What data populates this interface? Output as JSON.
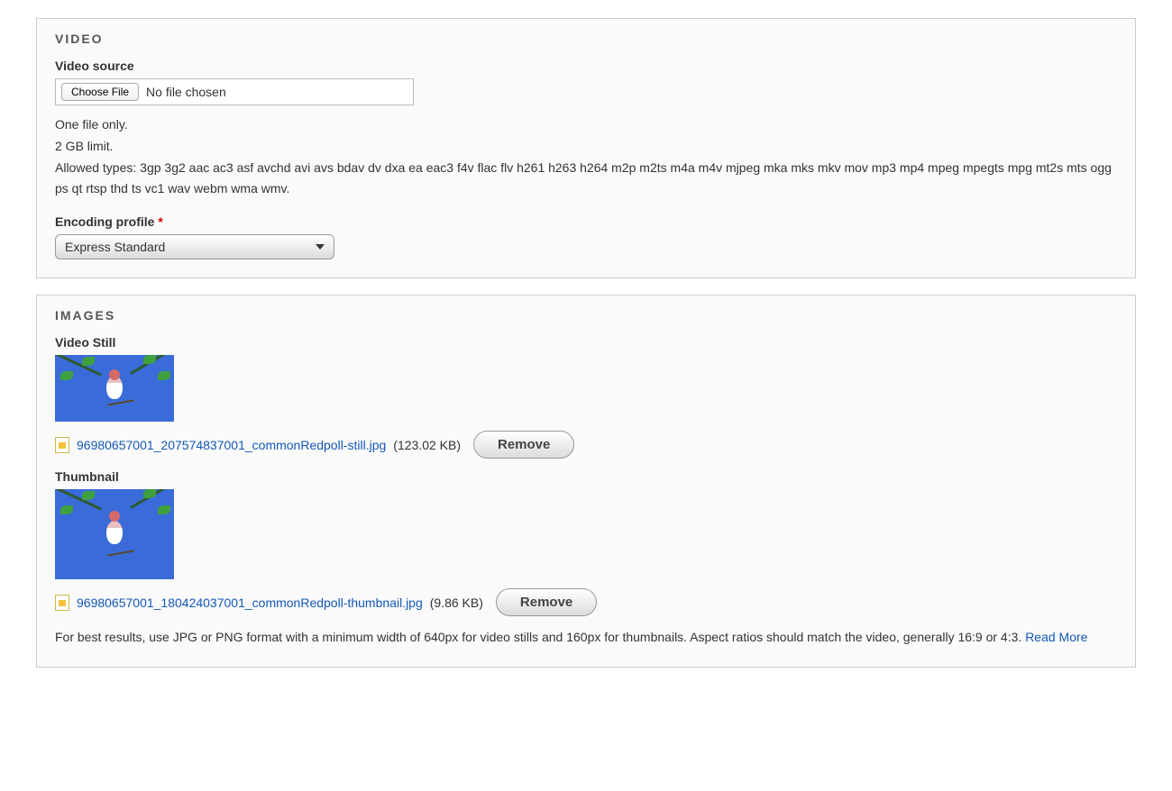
{
  "video_panel": {
    "title": "VIDEO",
    "source": {
      "label": "Video source",
      "choose_button": "Choose File",
      "status": "No file chosen",
      "help_line1": "One file only.",
      "help_line2": "2 GB limit.",
      "help_line3": "Allowed types: 3gp 3g2 aac ac3 asf avchd avi avs bdav dv dxa ea eac3 f4v flac flv h261 h263 h264 m2p m2ts m4a m4v mjpeg mka mks mkv mov mp3 mp4 mpeg mpegts mpg mt2s mts ogg ps qt rtsp thd ts vc1 wav webm wma wmv."
    },
    "encoding": {
      "label": "Encoding profile",
      "required_marker": "*",
      "selected": "Express Standard"
    }
  },
  "images_panel": {
    "title": "IMAGES",
    "video_still": {
      "label": "Video Still",
      "filename": "96980657001_207574837001_commonRedpoll-still.jpg",
      "size": "(123.02 KB)",
      "remove": "Remove"
    },
    "thumbnail": {
      "label": "Thumbnail",
      "filename": "96980657001_180424037001_commonRedpoll-thumbnail.jpg",
      "size": "(9.86 KB)",
      "remove": "Remove"
    },
    "hint_text": "For best results, use JPG or PNG format with a minimum width of 640px for video stills and 160px for thumbnails. Aspect ratios should match the video, generally 16:9 or 4:3. ",
    "read_more": "Read More"
  }
}
